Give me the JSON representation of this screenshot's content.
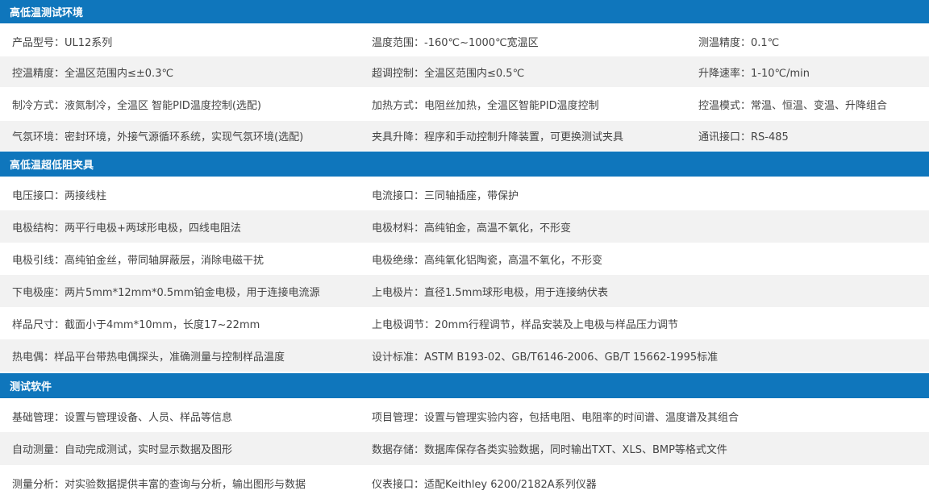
{
  "sections": [
    {
      "title": "高低温测试环境",
      "rows": [
        [
          "产品型号：UL12系列",
          "温度范围：-160℃~1000℃宽温区",
          "测温精度：0.1℃"
        ],
        [
          "控温精度：全温区范围内≤±0.3℃",
          "超调控制：全温区范围内≤0.5℃",
          "升降速率：1-10℃/min"
        ],
        [
          "制冷方式：液氮制冷，全温区 智能PID温度控制(选配)",
          "加热方式：电阻丝加热，全温区智能PID温度控制",
          "控温模式：常温、恒温、变温、升降组合"
        ],
        [
          "气氛环境：密封环境，外接气源循环系统，实现气氛环境(选配)",
          "夹具升降：程序和手动控制升降装置，可更换测试夹具",
          "通讯接口：RS-485"
        ]
      ]
    },
    {
      "title": "高低温超低阻夹具",
      "rows": [
        [
          "电压接口：两接线柱",
          "电流接口：三同轴插座，带保护"
        ],
        [
          "电极结构：两平行电极+两球形电极，四线电阻法",
          "电极材料：高纯铂金，高温不氧化，不形变"
        ],
        [
          "电极引线：高纯铂金丝，带同轴屏蔽层，消除电磁干扰",
          "电极绝缘：高纯氧化铝陶瓷，高温不氧化，不形变"
        ],
        [
          "下电极座：两片5mm*12mm*0.5mm铂金电极，用于连接电流源",
          "上电极片：直径1.5mm球形电极，用于连接纳伏表"
        ],
        [
          "样品尺寸：截面小于4mm*10mm，长度17~22mm",
          "上电极调节：20mm行程调节，样品安装及上电极与样品压力调节"
        ],
        [
          "热电偶：样品平台带热电偶探头，准确测量与控制样品温度",
          "设计标准：ASTM B193-02、GB/T6146-2006、GB/T 15662-1995标准"
        ]
      ]
    },
    {
      "title": "测试软件",
      "rows": [
        [
          "基础管理：设置与管理设备、人员、样品等信息",
          "项目管理：设置与管理实验内容，包括电阻、电阻率的时间谱、温度谱及其组合"
        ],
        [
          "自动测量：自动完成测试，实时显示数据及图形",
          "数据存储：数据库保存各类实验数据，同时输出TXT、XLS、BMP等格式文件"
        ],
        [
          "测量分析：对实验数据提供丰富的查询与分析，输出图形与数据",
          "仪表接口：适配Keithley 6200/2182A系列仪器"
        ]
      ]
    }
  ],
  "colors": {
    "header_bg": "#0f76bc",
    "header_text": "#ffffff",
    "row_shade": "#f2f2f2",
    "body_text": "#444444"
  }
}
